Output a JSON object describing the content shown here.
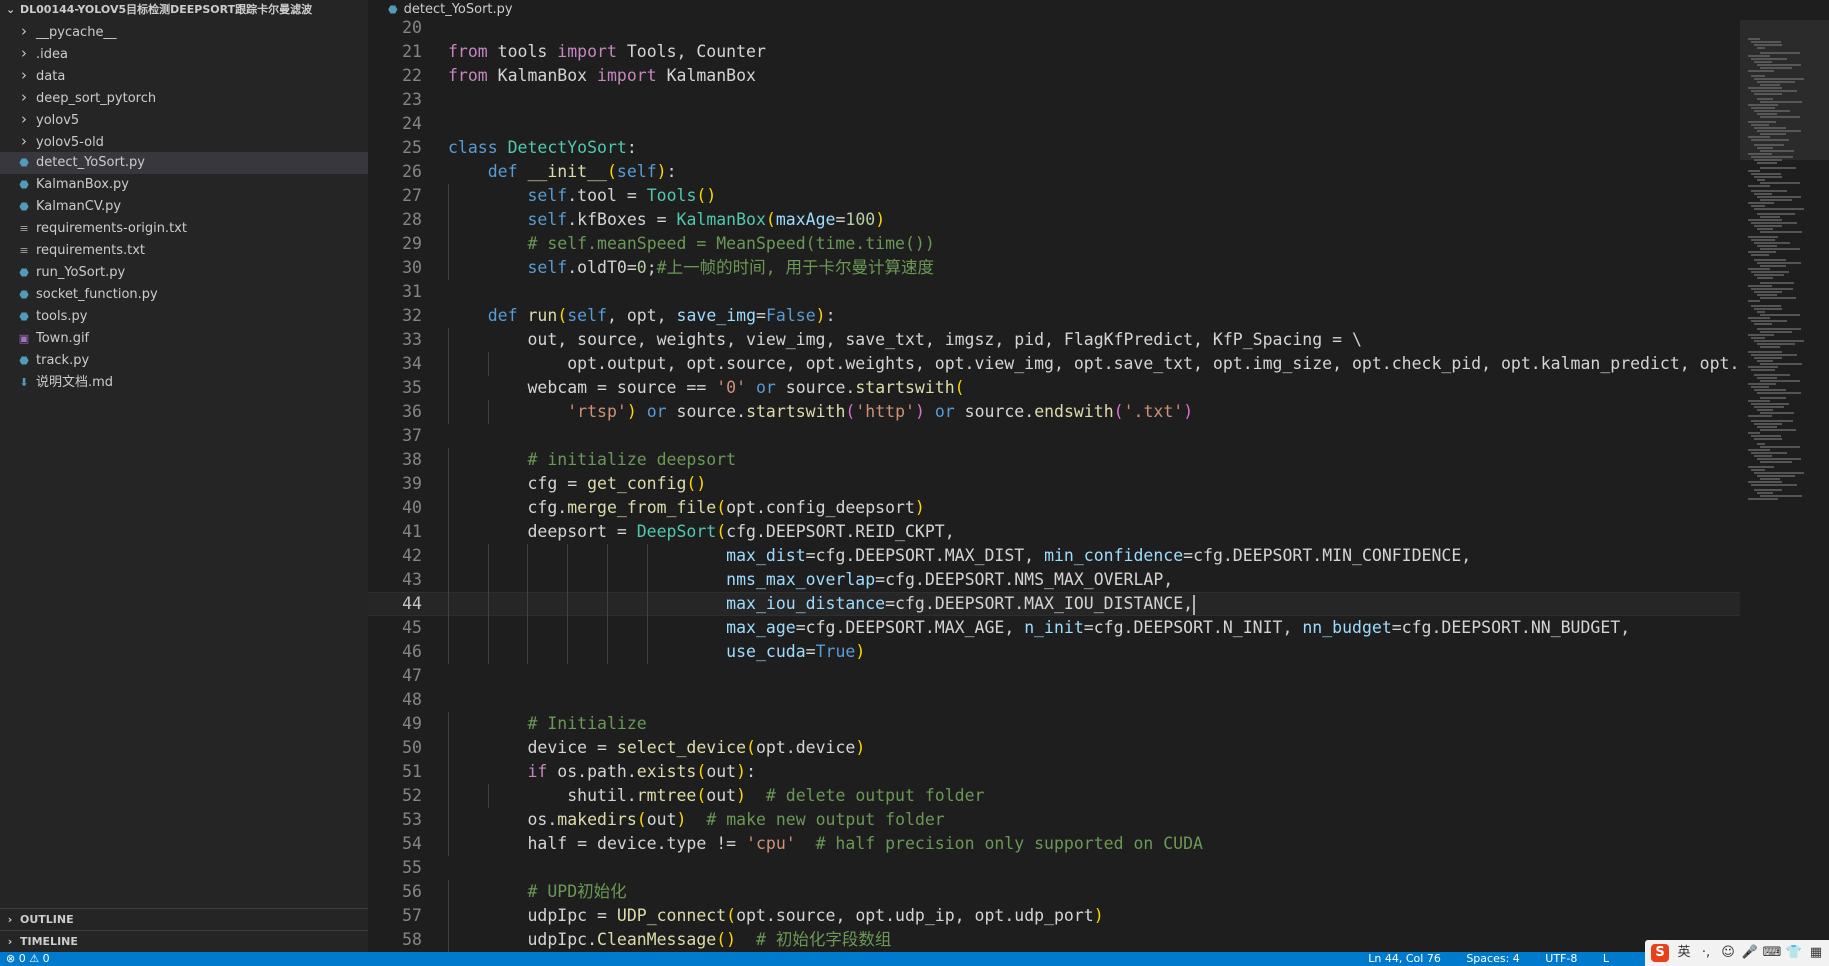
{
  "sidebar": {
    "project_title": "DL00144-YOLOV5目标检测DEEPSORT跟踪卡尔曼滤波",
    "items": [
      {
        "label": "__pycache__",
        "kind": "folder",
        "icon": "chevron-right-icon"
      },
      {
        "label": ".idea",
        "kind": "folder",
        "icon": "chevron-right-icon"
      },
      {
        "label": "data",
        "kind": "folder",
        "icon": "chevron-right-icon"
      },
      {
        "label": "deep_sort_pytorch",
        "kind": "folder",
        "icon": "chevron-right-icon"
      },
      {
        "label": "yolov5",
        "kind": "folder",
        "icon": "chevron-right-icon"
      },
      {
        "label": "yolov5-old",
        "kind": "folder",
        "icon": "chevron-right-icon"
      },
      {
        "label": "detect_YoSort.py",
        "kind": "py",
        "icon": "python-file-icon",
        "selected": true
      },
      {
        "label": "KalmanBox.py",
        "kind": "py",
        "icon": "python-file-icon"
      },
      {
        "label": "KalmanCV.py",
        "kind": "py",
        "icon": "python-file-icon"
      },
      {
        "label": "requirements-origin.txt",
        "kind": "txt",
        "icon": "text-file-icon"
      },
      {
        "label": "requirements.txt",
        "kind": "txt",
        "icon": "text-file-icon"
      },
      {
        "label": "run_YoSort.py",
        "kind": "py",
        "icon": "python-file-icon"
      },
      {
        "label": "socket_function.py",
        "kind": "py",
        "icon": "python-file-icon"
      },
      {
        "label": "tools.py",
        "kind": "py",
        "icon": "python-file-icon"
      },
      {
        "label": "Town.gif",
        "kind": "gif",
        "icon": "image-file-icon"
      },
      {
        "label": "track.py",
        "kind": "py",
        "icon": "python-file-icon"
      },
      {
        "label": "说明文档.md",
        "kind": "md",
        "icon": "markdown-file-icon"
      }
    ],
    "outline_label": "OUTLINE",
    "timeline_label": "TIMELINE"
  },
  "tabs": [
    {
      "label": "detect_YoSort.py",
      "icon": "python-file-icon"
    }
  ],
  "editor": {
    "current_line": 44,
    "lines": [
      {
        "n": "20"
      },
      {
        "n": "21"
      },
      {
        "n": "22"
      },
      {
        "n": "23"
      },
      {
        "n": "24"
      },
      {
        "n": "25"
      },
      {
        "n": "26"
      },
      {
        "n": "27"
      },
      {
        "n": "28"
      },
      {
        "n": "29"
      },
      {
        "n": "30"
      },
      {
        "n": "31"
      },
      {
        "n": "32"
      },
      {
        "n": "33"
      },
      {
        "n": "34"
      },
      {
        "n": "35"
      },
      {
        "n": "36"
      },
      {
        "n": "37"
      },
      {
        "n": "38"
      },
      {
        "n": "39"
      },
      {
        "n": "40"
      },
      {
        "n": "41"
      },
      {
        "n": "42"
      },
      {
        "n": "43"
      },
      {
        "n": "44"
      },
      {
        "n": "45"
      },
      {
        "n": "46"
      },
      {
        "n": "47"
      },
      {
        "n": "48"
      },
      {
        "n": "49"
      },
      {
        "n": "50"
      },
      {
        "n": "51"
      },
      {
        "n": "52"
      },
      {
        "n": "53"
      },
      {
        "n": "54"
      },
      {
        "n": "55"
      },
      {
        "n": "56"
      },
      {
        "n": "57"
      },
      {
        "n": "58"
      }
    ]
  },
  "statusbar": {
    "left": "⊗ 0  ⚠ 0",
    "position": "Ln 44, Col 76",
    "spaces": "Spaces: 4",
    "encoding": "UTF-8",
    "extra": "L"
  },
  "ime": {
    "logo": "S",
    "lang": "英",
    "items": [
      "·,",
      "☺",
      "🎤",
      "⌨",
      "👕",
      "▦"
    ]
  },
  "colors": {
    "status_bar": "#007acc",
    "editor_bg": "#1e1e1e",
    "sidebar_bg": "#252526",
    "keyword": "#569cd6",
    "control_keyword": "#c586c0",
    "function": "#dcdcaa",
    "class": "#4ec9b0",
    "string": "#ce9178",
    "comment": "#6a9955"
  }
}
